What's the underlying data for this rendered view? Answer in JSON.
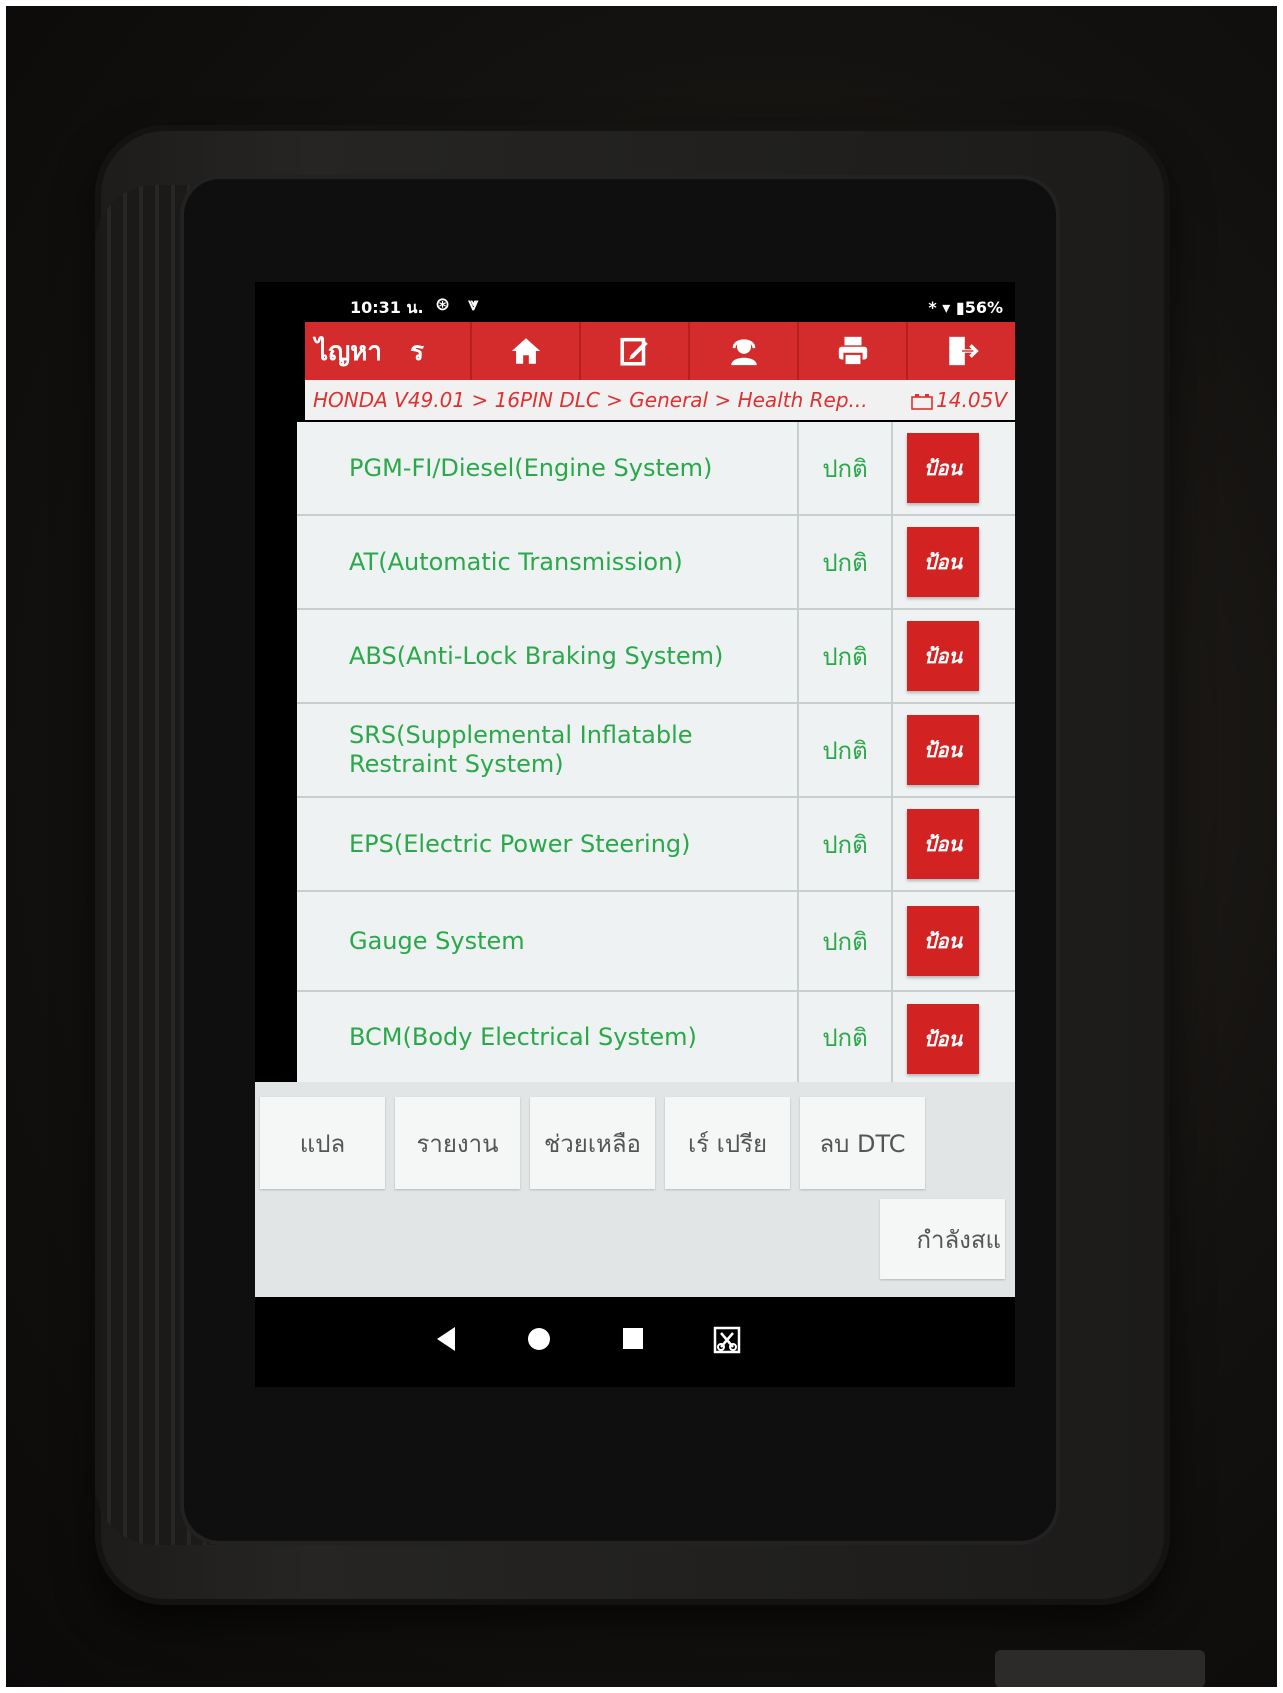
{
  "status_bar": {
    "time": "10:31 น.",
    "icons": "⊛ ⩔",
    "battery_label": "* ▾ ▮56%"
  },
  "app_bar": {
    "title": "ไญหา",
    "title_separator": "ร",
    "icons": [
      "home-icon",
      "edit-icon",
      "support-icon",
      "print-icon",
      "exit-icon"
    ],
    "accent_color": "#d42c2c"
  },
  "breadcrumb": {
    "path": "HONDA V49.01 > 16PIN DLC > General > Health Rep...",
    "voltage": "14.05V"
  },
  "systems": [
    {
      "name": "PGM-FI/Diesel(Engine System)",
      "status": "ปกติ",
      "action": "ป้อน"
    },
    {
      "name": "AT(Automatic Transmission)",
      "status": "ปกติ",
      "action": "ป้อน"
    },
    {
      "name": "ABS(Anti-Lock Braking System)",
      "status": "ปกติ",
      "action": "ป้อน"
    },
    {
      "name": "SRS(Supplemental Inflatable Restraint System)",
      "status": "ปกติ",
      "action": "ป้อน"
    },
    {
      "name": "EPS(Electric Power Steering)",
      "status": "ปกติ",
      "action": "ป้อน"
    },
    {
      "name": "Gauge System",
      "status": "ปกติ",
      "action": "ป้อน"
    },
    {
      "name": "BCM(Body Electrical System)",
      "status": "ปกติ",
      "action": "ป้อน"
    }
  ],
  "actions": {
    "translate": "แปล",
    "report": "รายงาน",
    "help": "ช่วยเหลือ",
    "compare": "เร์ เปรีย",
    "clear_dtc": "ลบ DTC",
    "scanning": "กำลังสแ"
  },
  "nav": [
    "back-icon",
    "home-circle-icon",
    "recents-icon",
    "screenshot-icon"
  ]
}
